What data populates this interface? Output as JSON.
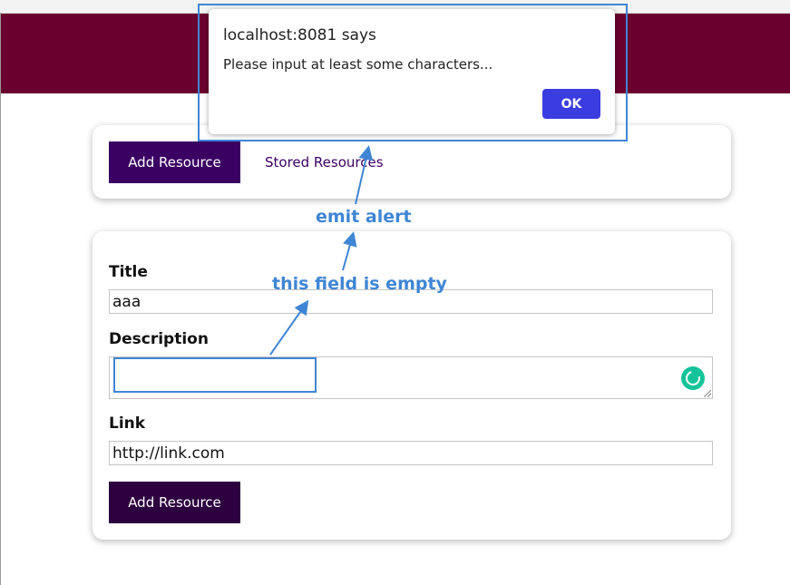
{
  "header": {
    "color": "#6a002e"
  },
  "nav": {
    "add_resource_label": "Add Resource",
    "stored_resources_label": "Stored Resources"
  },
  "form": {
    "title_label": "Title",
    "title_value": "aaa",
    "description_label": "Description",
    "description_value": "",
    "link_label": "Link",
    "link_value": "http://link.com",
    "submit_label": "Add Resource"
  },
  "dialog": {
    "title": "localhost:8081 says",
    "message": "Please input at least some characters...",
    "ok_label": "OK"
  },
  "annotations": {
    "alert_note": "emit alert",
    "empty_field_note": "this field is empty",
    "color": "#3f86d4"
  }
}
